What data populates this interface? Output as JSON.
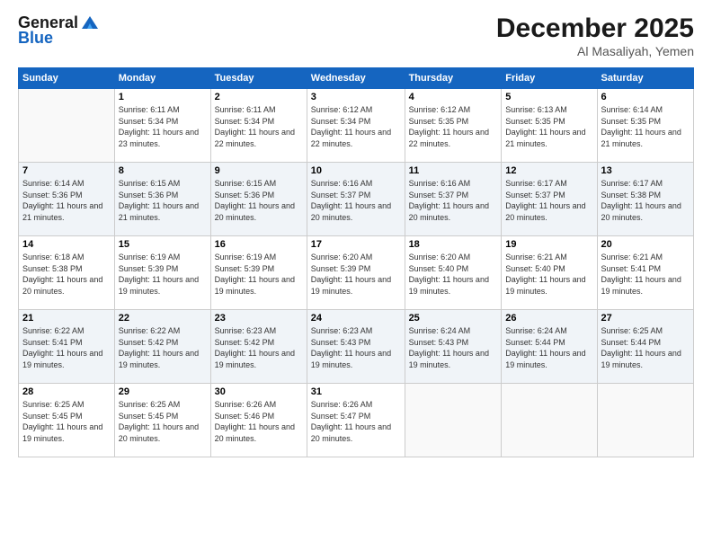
{
  "header": {
    "logo_line1": "General",
    "logo_line2": "Blue",
    "month": "December 2025",
    "location": "Al Masaliyah, Yemen"
  },
  "columns": [
    "Sunday",
    "Monday",
    "Tuesday",
    "Wednesday",
    "Thursday",
    "Friday",
    "Saturday"
  ],
  "weeks": [
    [
      {
        "day": "",
        "sunrise": "",
        "sunset": "",
        "daylight": ""
      },
      {
        "day": "1",
        "sunrise": "Sunrise: 6:11 AM",
        "sunset": "Sunset: 5:34 PM",
        "daylight": "Daylight: 11 hours and 23 minutes."
      },
      {
        "day": "2",
        "sunrise": "Sunrise: 6:11 AM",
        "sunset": "Sunset: 5:34 PM",
        "daylight": "Daylight: 11 hours and 22 minutes."
      },
      {
        "day": "3",
        "sunrise": "Sunrise: 6:12 AM",
        "sunset": "Sunset: 5:34 PM",
        "daylight": "Daylight: 11 hours and 22 minutes."
      },
      {
        "day": "4",
        "sunrise": "Sunrise: 6:12 AM",
        "sunset": "Sunset: 5:35 PM",
        "daylight": "Daylight: 11 hours and 22 minutes."
      },
      {
        "day": "5",
        "sunrise": "Sunrise: 6:13 AM",
        "sunset": "Sunset: 5:35 PM",
        "daylight": "Daylight: 11 hours and 21 minutes."
      },
      {
        "day": "6",
        "sunrise": "Sunrise: 6:14 AM",
        "sunset": "Sunset: 5:35 PM",
        "daylight": "Daylight: 11 hours and 21 minutes."
      }
    ],
    [
      {
        "day": "7",
        "sunrise": "Sunrise: 6:14 AM",
        "sunset": "Sunset: 5:36 PM",
        "daylight": "Daylight: 11 hours and 21 minutes."
      },
      {
        "day": "8",
        "sunrise": "Sunrise: 6:15 AM",
        "sunset": "Sunset: 5:36 PM",
        "daylight": "Daylight: 11 hours and 21 minutes."
      },
      {
        "day": "9",
        "sunrise": "Sunrise: 6:15 AM",
        "sunset": "Sunset: 5:36 PM",
        "daylight": "Daylight: 11 hours and 20 minutes."
      },
      {
        "day": "10",
        "sunrise": "Sunrise: 6:16 AM",
        "sunset": "Sunset: 5:37 PM",
        "daylight": "Daylight: 11 hours and 20 minutes."
      },
      {
        "day": "11",
        "sunrise": "Sunrise: 6:16 AM",
        "sunset": "Sunset: 5:37 PM",
        "daylight": "Daylight: 11 hours and 20 minutes."
      },
      {
        "day": "12",
        "sunrise": "Sunrise: 6:17 AM",
        "sunset": "Sunset: 5:37 PM",
        "daylight": "Daylight: 11 hours and 20 minutes."
      },
      {
        "day": "13",
        "sunrise": "Sunrise: 6:17 AM",
        "sunset": "Sunset: 5:38 PM",
        "daylight": "Daylight: 11 hours and 20 minutes."
      }
    ],
    [
      {
        "day": "14",
        "sunrise": "Sunrise: 6:18 AM",
        "sunset": "Sunset: 5:38 PM",
        "daylight": "Daylight: 11 hours and 20 minutes."
      },
      {
        "day": "15",
        "sunrise": "Sunrise: 6:19 AM",
        "sunset": "Sunset: 5:39 PM",
        "daylight": "Daylight: 11 hours and 19 minutes."
      },
      {
        "day": "16",
        "sunrise": "Sunrise: 6:19 AM",
        "sunset": "Sunset: 5:39 PM",
        "daylight": "Daylight: 11 hours and 19 minutes."
      },
      {
        "day": "17",
        "sunrise": "Sunrise: 6:20 AM",
        "sunset": "Sunset: 5:39 PM",
        "daylight": "Daylight: 11 hours and 19 minutes."
      },
      {
        "day": "18",
        "sunrise": "Sunrise: 6:20 AM",
        "sunset": "Sunset: 5:40 PM",
        "daylight": "Daylight: 11 hours and 19 minutes."
      },
      {
        "day": "19",
        "sunrise": "Sunrise: 6:21 AM",
        "sunset": "Sunset: 5:40 PM",
        "daylight": "Daylight: 11 hours and 19 minutes."
      },
      {
        "day": "20",
        "sunrise": "Sunrise: 6:21 AM",
        "sunset": "Sunset: 5:41 PM",
        "daylight": "Daylight: 11 hours and 19 minutes."
      }
    ],
    [
      {
        "day": "21",
        "sunrise": "Sunrise: 6:22 AM",
        "sunset": "Sunset: 5:41 PM",
        "daylight": "Daylight: 11 hours and 19 minutes."
      },
      {
        "day": "22",
        "sunrise": "Sunrise: 6:22 AM",
        "sunset": "Sunset: 5:42 PM",
        "daylight": "Daylight: 11 hours and 19 minutes."
      },
      {
        "day": "23",
        "sunrise": "Sunrise: 6:23 AM",
        "sunset": "Sunset: 5:42 PM",
        "daylight": "Daylight: 11 hours and 19 minutes."
      },
      {
        "day": "24",
        "sunrise": "Sunrise: 6:23 AM",
        "sunset": "Sunset: 5:43 PM",
        "daylight": "Daylight: 11 hours and 19 minutes."
      },
      {
        "day": "25",
        "sunrise": "Sunrise: 6:24 AM",
        "sunset": "Sunset: 5:43 PM",
        "daylight": "Daylight: 11 hours and 19 minutes."
      },
      {
        "day": "26",
        "sunrise": "Sunrise: 6:24 AM",
        "sunset": "Sunset: 5:44 PM",
        "daylight": "Daylight: 11 hours and 19 minutes."
      },
      {
        "day": "27",
        "sunrise": "Sunrise: 6:25 AM",
        "sunset": "Sunset: 5:44 PM",
        "daylight": "Daylight: 11 hours and 19 minutes."
      }
    ],
    [
      {
        "day": "28",
        "sunrise": "Sunrise: 6:25 AM",
        "sunset": "Sunset: 5:45 PM",
        "daylight": "Daylight: 11 hours and 19 minutes."
      },
      {
        "day": "29",
        "sunrise": "Sunrise: 6:25 AM",
        "sunset": "Sunset: 5:45 PM",
        "daylight": "Daylight: 11 hours and 20 minutes."
      },
      {
        "day": "30",
        "sunrise": "Sunrise: 6:26 AM",
        "sunset": "Sunset: 5:46 PM",
        "daylight": "Daylight: 11 hours and 20 minutes."
      },
      {
        "day": "31",
        "sunrise": "Sunrise: 6:26 AM",
        "sunset": "Sunset: 5:47 PM",
        "daylight": "Daylight: 11 hours and 20 minutes."
      },
      {
        "day": "",
        "sunrise": "",
        "sunset": "",
        "daylight": ""
      },
      {
        "day": "",
        "sunrise": "",
        "sunset": "",
        "daylight": ""
      },
      {
        "day": "",
        "sunrise": "",
        "sunset": "",
        "daylight": ""
      }
    ]
  ]
}
